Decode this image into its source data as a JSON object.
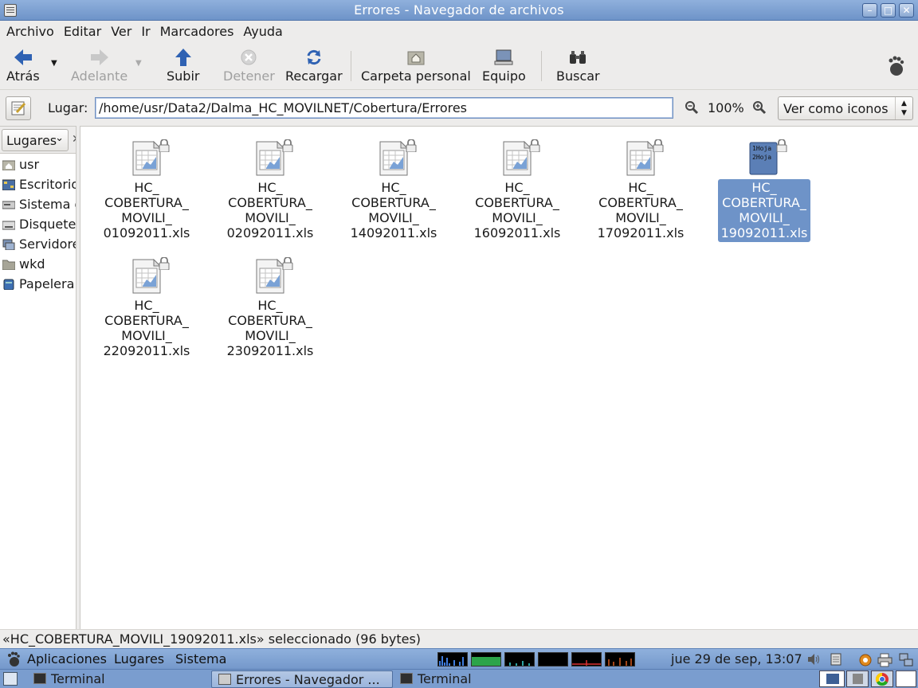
{
  "window": {
    "title": "Errores - Navegador de archivos"
  },
  "menu": [
    "Archivo",
    "Editar",
    "Ver",
    "Ir",
    "Marcadores",
    "Ayuda"
  ],
  "toolbar": {
    "back": "Atrás",
    "forward": "Adelante",
    "up": "Subir",
    "stop": "Detener",
    "reload": "Recargar",
    "home": "Carpeta personal",
    "computer": "Equipo",
    "search": "Buscar"
  },
  "location": {
    "label": "Lugar:",
    "path": "/home/usr/Data2/Dalma_HC_MOVILNET/Cobertura/Errores",
    "zoom": "100%",
    "view_mode": "Ver como iconos"
  },
  "sidebar": {
    "header": "Lugares",
    "items": [
      {
        "label": "usr",
        "icon": "home-folder-icon"
      },
      {
        "label": "Escritorio",
        "icon": "desktop-icon"
      },
      {
        "label": "Sistema de",
        "icon": "filesystem-icon"
      },
      {
        "label": "Disquetera",
        "icon": "floppy-icon"
      },
      {
        "label": "Servidores",
        "icon": "network-icon"
      },
      {
        "label": "wkd",
        "icon": "folder-icon"
      },
      {
        "label": "Papelera",
        "icon": "trash-icon"
      }
    ]
  },
  "files": [
    {
      "name": "HC_\nCOBERTURA_\nMOVILI_\n01092011.xls",
      "selected": false
    },
    {
      "name": "HC_\nCOBERTURA_\nMOVILI_\n02092011.xls",
      "selected": false
    },
    {
      "name": "HC_\nCOBERTURA_\nMOVILI_\n14092011.xls",
      "selected": false
    },
    {
      "name": "HC_\nCOBERTURA_\nMOVILI_\n16092011.xls",
      "selected": false
    },
    {
      "name": "HC_\nCOBERTURA_\nMOVILI_\n17092011.xls",
      "selected": false
    },
    {
      "name": "HC_\nCOBERTURA_\nMOVILI_\n19092011.xls",
      "selected": true,
      "preview": [
        "1Hoja",
        "2Hoja"
      ]
    },
    {
      "name": "HC_\nCOBERTURA_\nMOVILI_\n22092011.xls",
      "selected": false
    },
    {
      "name": "HC_\nCOBERTURA_\nMOVILI_\n23092011.xls",
      "selected": false
    }
  ],
  "status": "«HC_COBERTURA_MOVILI_19092011.xls» seleccionado (96 bytes)",
  "panel": {
    "menus": [
      "Aplicaciones",
      "Lugares",
      "Sistema"
    ],
    "clock": "jue 29 de sep, 13:07"
  },
  "taskbar": [
    {
      "label": "Terminal",
      "active": false
    },
    {
      "label": "Errores - Navegador ...",
      "active": true
    },
    {
      "label": "Terminal",
      "active": false
    }
  ],
  "colors": {
    "accent": "#6e93c8",
    "panel": "#8fb0dc"
  }
}
